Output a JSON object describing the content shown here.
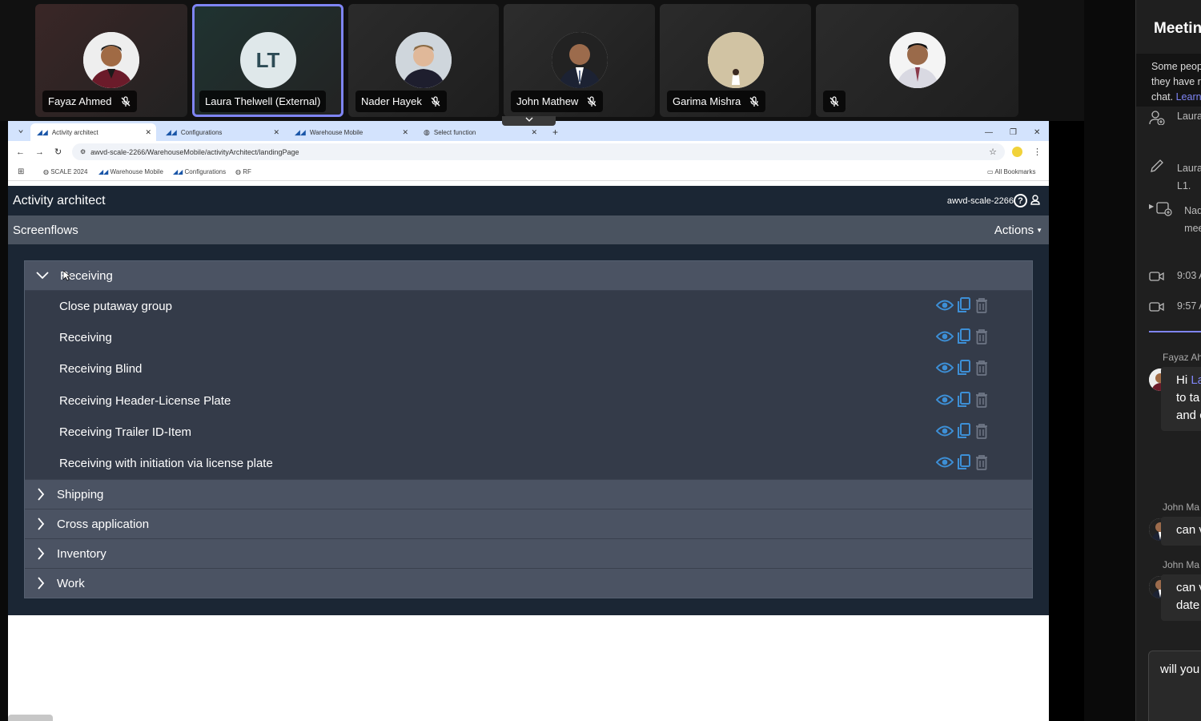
{
  "participants": [
    {
      "name": "Fayaz Ahmed",
      "muted": true,
      "avatar": "photo"
    },
    {
      "name": "Laura Thelwell (External)",
      "muted": false,
      "avatar": "initials",
      "initials": "LT",
      "speaking": true
    },
    {
      "name": "Nader Hayek",
      "muted": true,
      "avatar": "photo"
    },
    {
      "name": "John Mathew",
      "muted": true,
      "avatar": "photo"
    },
    {
      "name": "Garima Mishra",
      "muted": true,
      "avatar": "photo"
    },
    {
      "name": "",
      "muted": true,
      "avatar": "photo"
    }
  ],
  "browser": {
    "tabs": [
      "Activity architect",
      "Configurations",
      "Warehouse Mobile",
      "Select function"
    ],
    "url": "awvd-scale-2266/WarehouseMobile/activityArchitect/landingPage",
    "bookmarks": [
      "SCALE 2024",
      "Warehouse Mobile",
      "Configurations",
      "RF"
    ],
    "all_bookmarks": "All Bookmarks"
  },
  "app": {
    "title": "Activity architect",
    "env": "awvd-scale-2266",
    "section": "Screenflows",
    "actions_label": "Actions",
    "expanded_group": "Receiving",
    "items": [
      "Close putaway group",
      "Receiving",
      "Receiving Blind",
      "Receiving Header-License Plate",
      "Receiving Trailer ID-Item",
      "Receiving with initiation via license plate"
    ],
    "collapsed_groups": [
      "Shipping",
      "Cross application",
      "Inventory",
      "Work"
    ]
  },
  "sidebar": {
    "title": "Meetin",
    "notice": [
      "Some peop",
      "they have r",
      "chat."
    ],
    "notice_link": "Learn",
    "events": [
      {
        "icon": "person-add-icon",
        "lines": [
          "Laura"
        ]
      },
      {
        "icon": "pencil-icon",
        "lines": [
          "Laura",
          "L1."
        ]
      },
      {
        "icon": "meeting-add-icon",
        "lines": [
          "Nade",
          "meet"
        ]
      },
      {
        "icon": "video-icon",
        "lines": [
          "9:03 A"
        ]
      },
      {
        "icon": "video-icon",
        "lines": [
          "9:57 A"
        ]
      }
    ],
    "messages": [
      {
        "sender": "Fayaz Ah",
        "lines": [
          "Hi",
          "to ta",
          "and c"
        ],
        "mention": "La"
      },
      {
        "sender": "John Ma",
        "lines": [
          "can v"
        ]
      },
      {
        "sender": "John Ma",
        "lines": [
          "can v",
          "date"
        ]
      }
    ],
    "compose_text": "will you"
  },
  "colors": {
    "accent": "#7f85f5",
    "app_bg": "#1b2634",
    "panel_bg": "#343b49",
    "icon_blue": "#3d8fd6"
  }
}
